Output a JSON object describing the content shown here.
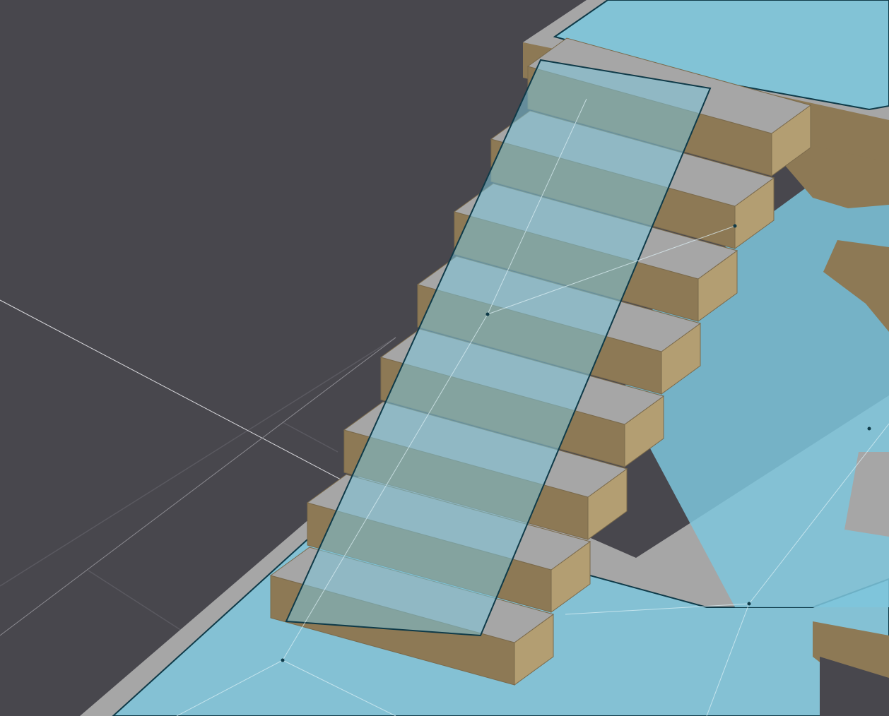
{
  "viewport": {
    "type": "3d-editor-viewport",
    "scene": "navigation-mesh-debug-staircase",
    "background_color": "#48474d",
    "grid_color": "#5a5960",
    "axis_x_color": "#d8d8dc",
    "navmesh_fill": "#7ec6dc",
    "navmesh_edge": "#0f3a48",
    "floor_top_color": "#a6a6a6",
    "wall_color": "#8d7955",
    "wall_light_color": "#b39e72"
  },
  "staircase": {
    "step_count": 8
  }
}
